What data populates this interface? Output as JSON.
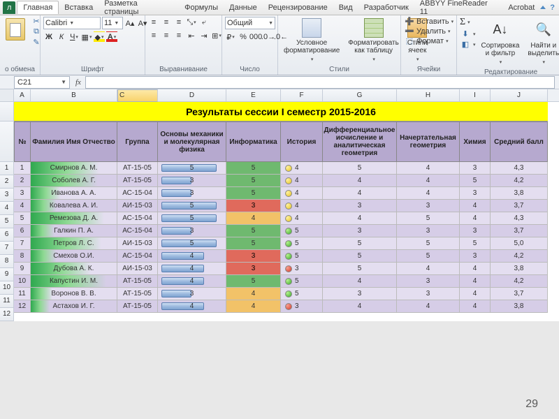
{
  "ribbon": {
    "tabs": [
      "Главная",
      "Вставка",
      "Разметка страницы",
      "Формулы",
      "Данные",
      "Рецензирование",
      "Вид",
      "Разработчик",
      "ABBYY FineReader 11",
      "Acrobat"
    ],
    "file_tab_visible_fragment": "л",
    "groups": {
      "clipboard": "о обмена",
      "font": "Шрифт",
      "alignment": "Выравнивание",
      "number": "Число",
      "styles": "Стили",
      "cells": "Ячейки",
      "editing": "Редактирование"
    },
    "font_name": "Calibri",
    "font_size": "11",
    "number_format": "Общий",
    "cond_format": "Условное форматирование",
    "fmt_table": "Форматировать как таблицу",
    "cell_styles": "Стили ячеек",
    "insert": "Вставить",
    "delete": "Удалить",
    "format": "Формат",
    "sort": "Сортировка и фильтр",
    "find": "Найти и выделить"
  },
  "namebox": "C21",
  "fx": "fx",
  "columns": [
    "A",
    "B",
    "C",
    "D",
    "E",
    "F",
    "G",
    "H",
    "I",
    "J"
  ],
  "title": "Результаты сессии I семестр 2015-2016",
  "headers": {
    "n": "№",
    "fio": "Фамилия Имя Отчество",
    "group": "Группа",
    "mech": "Основы механики и молекулярная физика",
    "inf": "Информатика",
    "hist": "История",
    "diff": "Дифференциальное исчисление и аналитическая геометрия",
    "nach": "Начертательная геометрия",
    "chem": "Химия",
    "avg": "Средний балл"
  },
  "rows": [
    {
      "n": 1,
      "fio": "Смирнов А. М.",
      "nf": 80,
      "g": "АТ-15-05",
      "d": 5,
      "e": 5,
      "f": 4,
      "fc": "y",
      "g2": 5,
      "h": 4,
      "i": 3,
      "avg": "4,3"
    },
    {
      "n": 2,
      "fio": "Соболев А. Г.",
      "nf": 78,
      "g": "АТ-15-05",
      "d": 3,
      "e": 5,
      "f": 4,
      "fc": "y",
      "g2": 4,
      "h": 4,
      "i": 5,
      "avg": "4,2"
    },
    {
      "n": 3,
      "fio": "Иванова А. А.",
      "nf": 35,
      "g": "АС-15-04",
      "d": 3,
      "e": 5,
      "f": 4,
      "fc": "y",
      "g2": 4,
      "h": 4,
      "i": 3,
      "avg": "3,8"
    },
    {
      "n": 4,
      "fio": "Ковалева А. И.",
      "nf": 30,
      "g": "АИ-15-03",
      "d": 5,
      "e": 3,
      "f": 4,
      "fc": "y",
      "g2": 3,
      "h": 3,
      "i": 4,
      "avg": "3,7"
    },
    {
      "n": 5,
      "fio": "Ремезова Д. А.",
      "nf": 85,
      "g": "АС-15-04",
      "d": 5,
      "e": 4,
      "f": 4,
      "fc": "y",
      "g2": 4,
      "h": 5,
      "i": 4,
      "avg": "4,3"
    },
    {
      "n": 6,
      "fio": "Галкин П. А.",
      "nf": 28,
      "g": "АС-15-04",
      "d": 3,
      "e": 5,
      "f": 5,
      "fc": "g",
      "g2": 3,
      "h": 3,
      "i": 3,
      "avg": "3,7"
    },
    {
      "n": 7,
      "fio": "Петров Л. С.",
      "nf": 82,
      "g": "АИ-15-03",
      "d": 5,
      "e": 5,
      "f": 5,
      "fc": "g",
      "g2": 5,
      "h": 5,
      "i": 5,
      "avg": "5,0"
    },
    {
      "n": 8,
      "fio": "Смехов О.И.",
      "nf": 30,
      "g": "АС-15-04",
      "d": 4,
      "e": 3,
      "f": 5,
      "fc": "g",
      "g2": 5,
      "h": 5,
      "i": 3,
      "avg": "4,2"
    },
    {
      "n": 9,
      "fio": "Дубова А. К.",
      "nf": 70,
      "g": "АИ-15-03",
      "d": 4,
      "e": 3,
      "f": 3,
      "fc": "r",
      "g2": 5,
      "h": 4,
      "i": 4,
      "avg": "3,8"
    },
    {
      "n": 10,
      "fio": "Капустин И. М.",
      "nf": 88,
      "g": "АТ-15-05",
      "d": 4,
      "e": 5,
      "f": 5,
      "fc": "g",
      "g2": 4,
      "h": 3,
      "i": 4,
      "avg": "4,2"
    },
    {
      "n": 11,
      "fio": "Воронов В. В.",
      "nf": 25,
      "g": "АТ-15-05",
      "d": 3,
      "e": 4,
      "f": 5,
      "fc": "g",
      "g2": 3,
      "h": 3,
      "i": 4,
      "avg": "3,7"
    },
    {
      "n": 12,
      "fio": "Астахов И. Г.",
      "nf": 22,
      "g": "АТ-15-05",
      "d": 4,
      "e": 4,
      "f": 3,
      "fc": "r",
      "g2": 4,
      "h": 4,
      "i": 4,
      "avg": "3,8"
    }
  ],
  "page_number": "29",
  "chart_data": {
    "type": "table",
    "title": "Результаты сессии I семестр 2015-2016",
    "columns": [
      "№",
      "Фамилия Имя Отчество",
      "Группа",
      "Основы механики и молекулярная физика",
      "Информатика",
      "История",
      "Дифференциальное исчисление и аналитическая геометрия",
      "Начертательная геометрия",
      "Химия",
      "Средний балл"
    ],
    "rows": [
      [
        1,
        "Смирнов А. М.",
        "АТ-15-05",
        5,
        5,
        4,
        5,
        4,
        3,
        4.3
      ],
      [
        2,
        "Соболев А. Г.",
        "АТ-15-05",
        3,
        5,
        4,
        4,
        4,
        5,
        4.2
      ],
      [
        3,
        "Иванова А. А.",
        "АС-15-04",
        3,
        5,
        4,
        4,
        4,
        3,
        3.8
      ],
      [
        4,
        "Ковалева А. И.",
        "АИ-15-03",
        5,
        3,
        4,
        3,
        3,
        4,
        3.7
      ],
      [
        5,
        "Ремезова Д. А.",
        "АС-15-04",
        5,
        4,
        4,
        4,
        5,
        4,
        4.3
      ],
      [
        6,
        "Галкин П. А.",
        "АС-15-04",
        3,
        5,
        5,
        3,
        3,
        3,
        3.7
      ],
      [
        7,
        "Петров Л. С.",
        "АИ-15-03",
        5,
        5,
        5,
        5,
        5,
        5,
        5.0
      ],
      [
        8,
        "Смехов О.И.",
        "АС-15-04",
        4,
        3,
        5,
        5,
        5,
        3,
        4.2
      ],
      [
        9,
        "Дубова А. К.",
        "АИ-15-03",
        4,
        3,
        3,
        5,
        4,
        4,
        3.8
      ],
      [
        10,
        "Капустин И. М.",
        "АТ-15-05",
        4,
        5,
        5,
        4,
        3,
        4,
        4.2
      ],
      [
        11,
        "Воронов В. В.",
        "АТ-15-05",
        3,
        4,
        5,
        3,
        3,
        4,
        3.7
      ],
      [
        12,
        "Астахов И. Г.",
        "АТ-15-05",
        4,
        4,
        3,
        4,
        4,
        4,
        3.8
      ]
    ]
  }
}
